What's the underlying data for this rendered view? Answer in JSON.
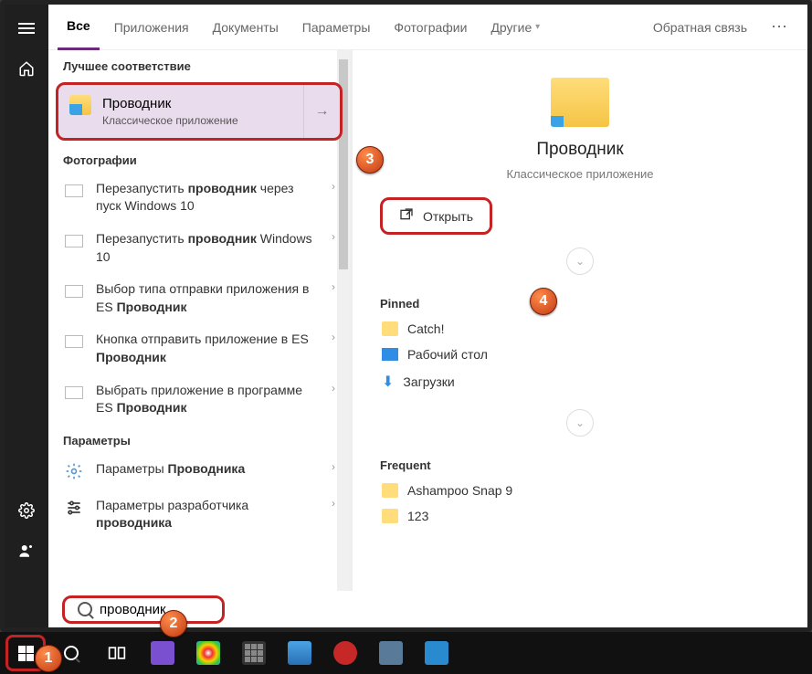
{
  "tabs": {
    "items": [
      "Все",
      "Приложения",
      "Документы",
      "Параметры",
      "Фотографии"
    ],
    "more": "Другие",
    "feedback": "Обратная связь"
  },
  "sections": {
    "best": "Лучшее соответствие",
    "photos": "Фотографии",
    "settings": "Параметры"
  },
  "best": {
    "title": "Проводник",
    "sub": "Классическое приложение"
  },
  "photos": [
    {
      "pre": "Перезапустить ",
      "bold": "проводник",
      "post": " через пуск Windows 10"
    },
    {
      "pre": "Перезапустить ",
      "bold": "проводник",
      "post": " Windows 10"
    },
    {
      "pre": "Выбор типа отправки приложения в ES ",
      "bold": "Проводник",
      "post": ""
    },
    {
      "pre": "Кнопка отправить приложение в ES ",
      "bold": "Проводник",
      "post": ""
    },
    {
      "pre": "Выбрать приложение в программе ES ",
      "bold": "Проводник",
      "post": ""
    }
  ],
  "settings": [
    {
      "pre": "Параметры ",
      "bold": "Проводника",
      "post": ""
    },
    {
      "pre": "Параметры разработчика ",
      "bold": "проводника",
      "post": ""
    }
  ],
  "preview": {
    "title": "Проводник",
    "sub": "Классическое приложение",
    "open": "Открыть",
    "pinned_h": "Pinned",
    "pinned": [
      "Catch!",
      "Рабочий стол",
      "Загрузки"
    ],
    "frequent_h": "Frequent",
    "frequent": [
      "Ashampoo Snap 9",
      "123"
    ]
  },
  "search": {
    "value": "проводник"
  },
  "callouts": {
    "c1": "1",
    "c2": "2",
    "c3": "3",
    "c4": "4"
  }
}
